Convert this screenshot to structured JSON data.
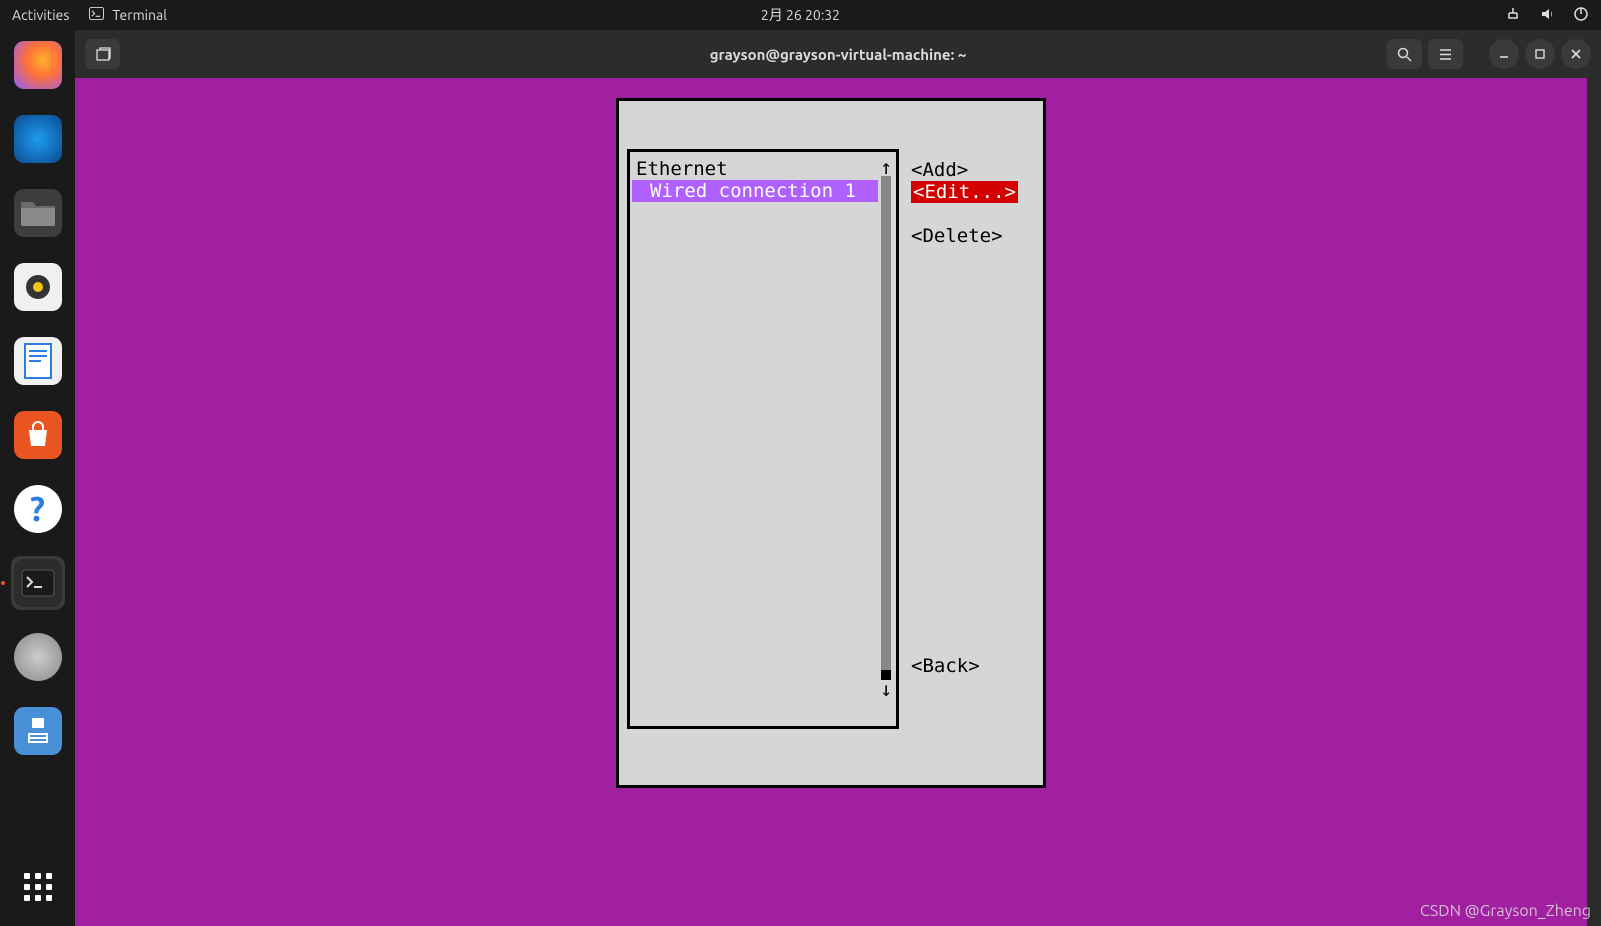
{
  "topbar": {
    "activities": "Activities",
    "app_name": "Terminal",
    "clock": "2月 26  20:32"
  },
  "window": {
    "title": "grayson@grayson-virtual-machine: ~"
  },
  "nmtui": {
    "category": "Ethernet",
    "connection": "Wired connection 1",
    "actions": {
      "add": "<Add>",
      "edit": "<Edit...>",
      "delete": "<Delete>",
      "back": "<Back>"
    }
  },
  "watermark": "CSDN @Grayson_Zheng",
  "dock": {
    "firefox": "Firefox",
    "thunderbird": "Thunderbird",
    "files": "Files",
    "rhythmbox": "Rhythmbox",
    "writer": "LibreOffice Writer",
    "software": "Ubuntu Software",
    "help": "Help",
    "terminal": "Terminal",
    "disk": "Disk",
    "save": "Save",
    "apps": "Show Applications"
  }
}
